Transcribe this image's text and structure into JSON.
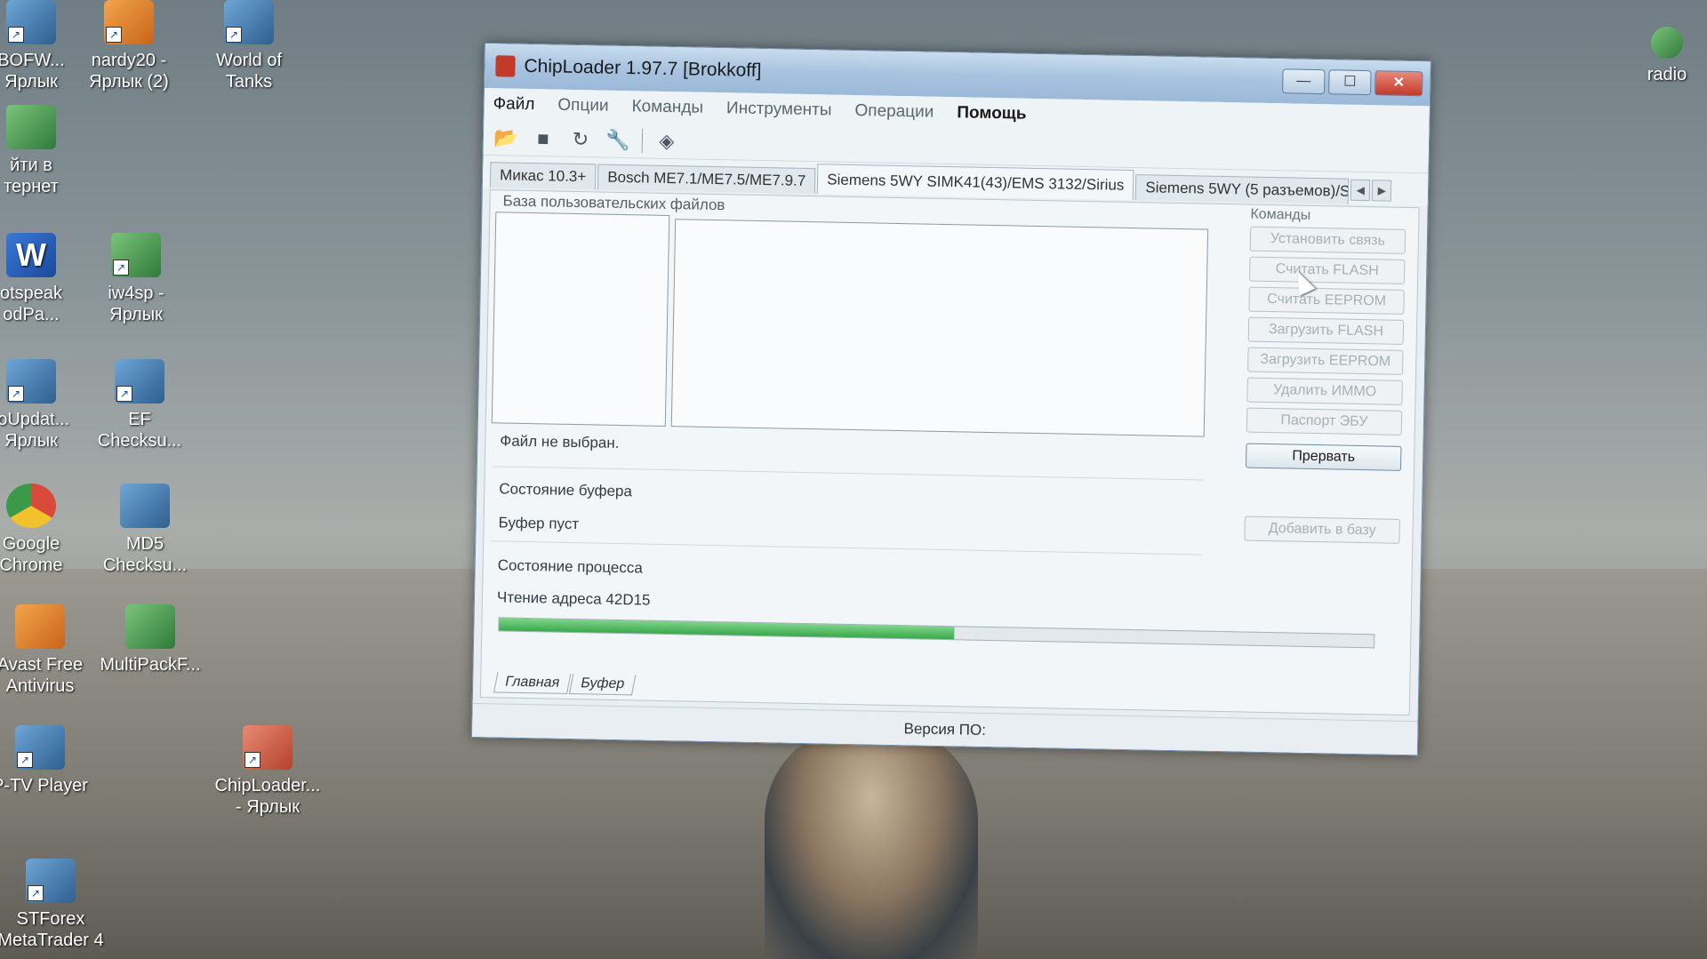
{
  "desktop": {
    "icons": [
      {
        "label": "BOFW...\nЯрлык"
      },
      {
        "label": "nardy20 -\nЯрлык (2)"
      },
      {
        "label": "World of\nTanks"
      },
      {
        "label": "йти в\nтернет"
      },
      {
        "label": "otspeak\nodPa..."
      },
      {
        "label": "iw4sp -\nЯрлык"
      },
      {
        "label": "toUpdat...\nЯрлык"
      },
      {
        "label": "EF\nChecksu..."
      },
      {
        "label": "Google\nChrome"
      },
      {
        "label": "MD5\nChecksu..."
      },
      {
        "label": "Avast Free\nAntivirus"
      },
      {
        "label": "MultiPackF..."
      },
      {
        "label": "P-TV Player"
      },
      {
        "label": "ChipLoader...\n- Ярлык"
      },
      {
        "label": "STForex\nMetaTrader 4"
      },
      {
        "label": "radio"
      }
    ]
  },
  "window": {
    "title": "ChipLoader 1.97.7 [Brokkoff]",
    "controls": {
      "minimize": "—",
      "maximize": "☐",
      "close": "✕"
    },
    "menu": [
      "Файл",
      "Опции",
      "Команды",
      "Инструменты",
      "Операции",
      "Помощь"
    ],
    "toolbar_icons": [
      "open-folder-icon",
      "stop-icon",
      "refresh-icon",
      "wrench-icon",
      "chip-icon"
    ],
    "tabs": [
      "Микас 10.3+",
      "Bosch ME7.1/ME7.5/ME7.9.7",
      "Siemens 5WY SIMK41(43)/EMS 3132/Sirius",
      "Siemens 5WY (5 разъемов)/S"
    ],
    "active_tab": "Siemens 5WY SIMK41(43)/EMS 3132/Sirius",
    "files_group_label": "База пользовательских файлов",
    "file_status": "Файл не выбран.",
    "buffer_state_label": "Состояние буфера",
    "buffer_state_value": "Буфер пуст",
    "process_state_label": "Состояние процесса",
    "process_state_value": "Чтение адреса 42D15",
    "progress_fraction": 0.52,
    "commands_label": "Команды",
    "commands": [
      {
        "label": "Установить связь",
        "enabled": false
      },
      {
        "label": "Считать FLASH",
        "enabled": false
      },
      {
        "label": "Считать EEPROM",
        "enabled": false
      },
      {
        "label": "Загрузить FLASH",
        "enabled": false
      },
      {
        "label": "Загрузить EEPROM",
        "enabled": false
      },
      {
        "label": "Удалить ИММО",
        "enabled": false
      },
      {
        "label": "Паспорт ЭБУ",
        "enabled": false
      },
      {
        "label": "Прервать",
        "enabled": true
      },
      {
        "label": "Добавить в базу",
        "enabled": false
      }
    ],
    "bottom_tabs": [
      "Главная",
      "Буфер"
    ],
    "status_bar": "Версия ПО:"
  },
  "colors": {
    "progress": "#3aa84c",
    "close_button": "#c23a2a",
    "titlebar": "#a8c3df"
  }
}
